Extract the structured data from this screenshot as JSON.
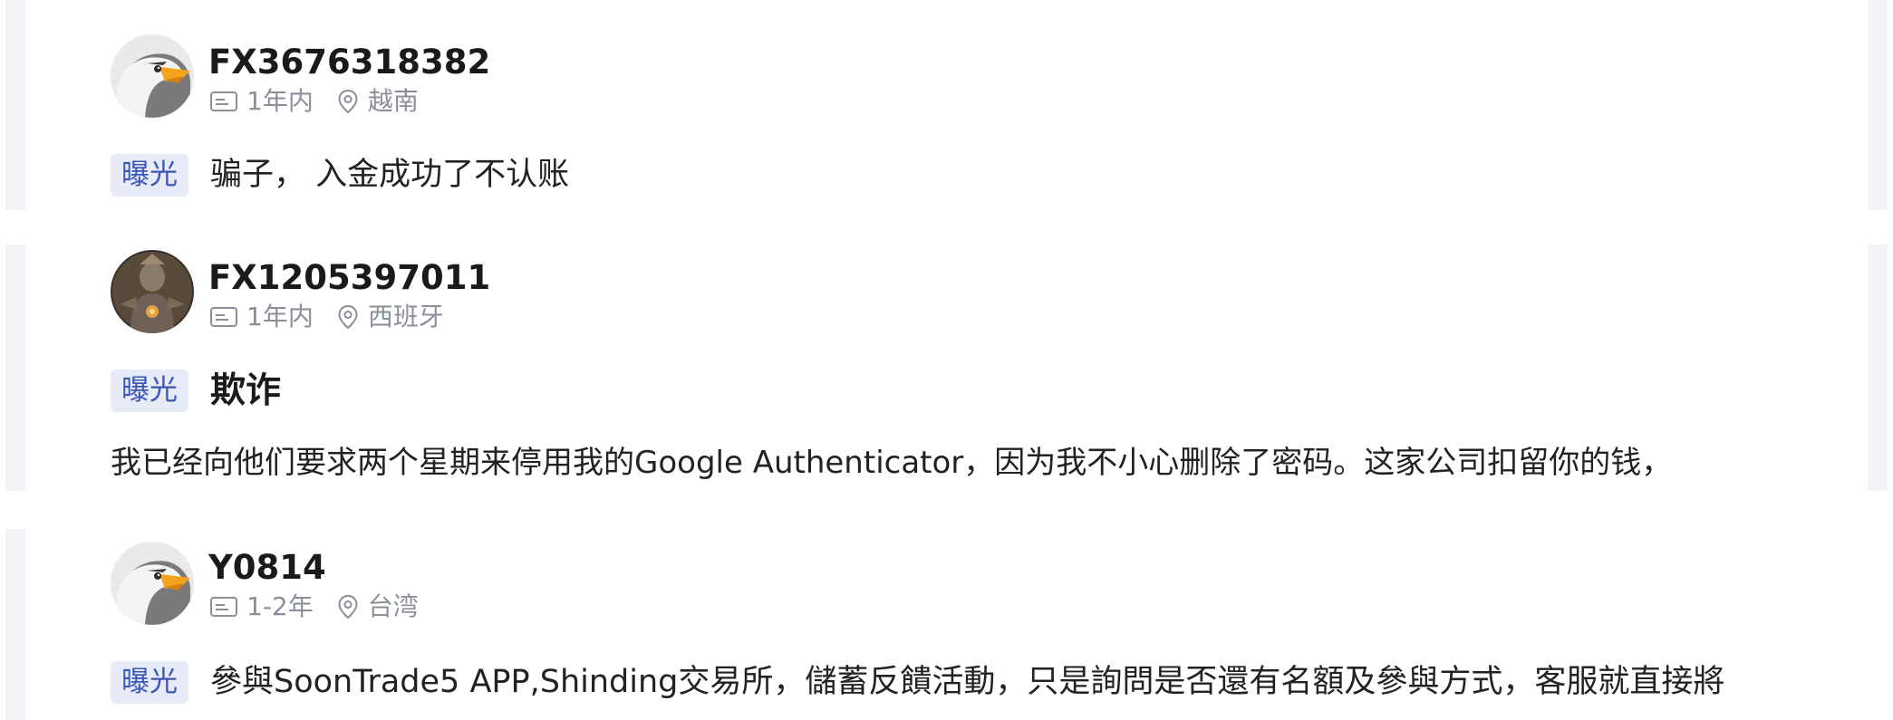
{
  "reviews": [
    {
      "username": "FX3676318382",
      "duration": "1年内",
      "location": "越南",
      "badge": "曝光",
      "title": "骗子， 入金成功了不认账",
      "body": ""
    },
    {
      "username": "FX1205397011",
      "duration": "1年内",
      "location": "西班牙",
      "badge": "曝光",
      "title": "欺诈",
      "body": "我已经向他们要求两个星期来停用我的Google Authenticator，因为我不小心删除了密码。这家公司扣留你的钱，"
    },
    {
      "username": "Y0814",
      "duration": "1-2年",
      "location": "台湾",
      "badge": "曝光",
      "title": "參與SoonTrade5 APP,Shinding交易所，儲蓄反饋活動，只是詢問是否還有名額及參與方式，客服就直接將",
      "body": ""
    }
  ],
  "icons": {
    "duration": "id-card-icon",
    "location": "location-pin-icon",
    "avatar_eagle": "eagle-avatar",
    "avatar_deity": "deity-avatar"
  },
  "colors": {
    "badge_bg": "#e6ebf7",
    "badge_text": "#3b56b8",
    "meta_text": "#8a8f99",
    "rail": "#f3f4f8"
  }
}
